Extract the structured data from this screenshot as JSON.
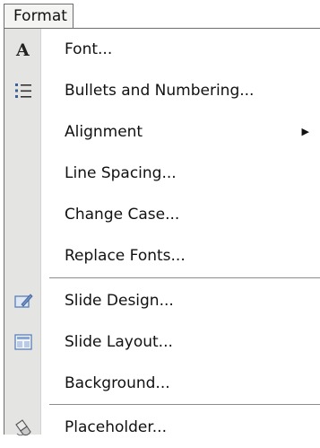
{
  "menu_title": "Format",
  "items": [
    {
      "label": "Font...",
      "icon": "font-icon"
    },
    {
      "label": "Bullets and Numbering...",
      "icon": "bullets-icon"
    },
    {
      "label": "Alignment",
      "submenu": true
    },
    {
      "label": "Line Spacing..."
    },
    {
      "label": "Change Case..."
    },
    {
      "label": "Replace Fonts..."
    },
    {
      "label": "Slide Design...",
      "icon": "slide-design-icon"
    },
    {
      "label": "Slide Layout...",
      "icon": "slide-layout-icon"
    },
    {
      "label": "Background..."
    },
    {
      "label": "Placeholder...",
      "icon": "placeholder-icon"
    }
  ],
  "colors": {
    "icon_strip": "#e4e4e2",
    "border": "#6e6e6e",
    "icon_blue": "#5a7fb8"
  }
}
